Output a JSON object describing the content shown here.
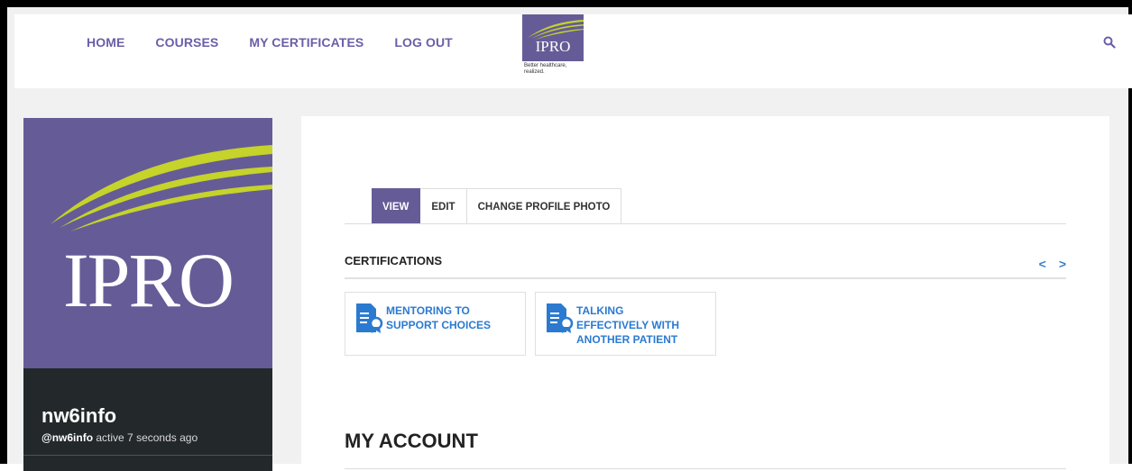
{
  "nav": {
    "items": [
      {
        "label": "HOME"
      },
      {
        "label": "COURSES"
      },
      {
        "label": "MY CERTIFICATES"
      },
      {
        "label": "LOG OUT"
      }
    ],
    "search_icon": "search-icon"
  },
  "header_logo": {
    "text": "IPRO",
    "tagline_line1": "Better healthcare,",
    "tagline_line2": "realized."
  },
  "profile": {
    "avatar_text": "IPRO",
    "username": "nw6info",
    "handle": "@nw6info",
    "activity": "active 7 seconds ago"
  },
  "tabs": [
    {
      "label": "VIEW",
      "active": true
    },
    {
      "label": "EDIT",
      "active": false
    },
    {
      "label": "CHANGE PROFILE PHOTO",
      "active": false
    }
  ],
  "certifications": {
    "title": "CERTIFICATIONS",
    "prev": "<",
    "next": ">",
    "items": [
      {
        "line1": "MENTORING TO",
        "line2": "SUPPORT CHOICES",
        "line3": ""
      },
      {
        "line1": "TALKING",
        "line2": "EFFECTIVELY WITH",
        "line3": "ANOTHER PATIENT"
      }
    ]
  },
  "account": {
    "title": "MY ACCOUNT"
  },
  "colors": {
    "brand_purple": "#655c97",
    "nav_text": "#6b5fa8",
    "link_blue": "#2b7ad0",
    "logo_lime": "#c5d32a",
    "profile_dark": "#23292b"
  }
}
